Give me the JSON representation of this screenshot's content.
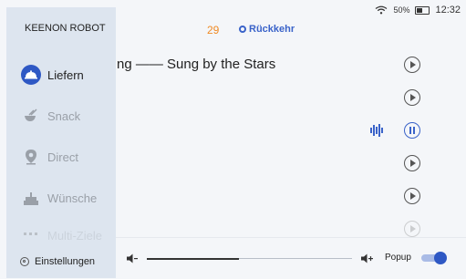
{
  "status": {
    "battery": "50%",
    "time": "12:32"
  },
  "header": {
    "count": "29",
    "back_label": "Rückkehr"
  },
  "songs": [
    {
      "title": "ng —— Sung by the Stars",
      "state": "play"
    },
    {
      "title": "",
      "state": "play"
    },
    {
      "title": "",
      "state": "playing"
    },
    {
      "title": "",
      "state": "play"
    },
    {
      "title": "",
      "state": "play"
    },
    {
      "title": "",
      "state": "play"
    }
  ],
  "sidebar": {
    "brand": "KEENON ROBOT",
    "items": [
      {
        "label": "Liefern",
        "icon": "cloche-icon",
        "active": true
      },
      {
        "label": "Snack",
        "icon": "snack-icon",
        "active": false
      },
      {
        "label": "Direct",
        "icon": "location-pin-icon",
        "active": false
      },
      {
        "label": "Wünsche",
        "icon": "cake-icon",
        "active": false
      },
      {
        "label": "Multi-Ziele",
        "icon": "grid-icon",
        "active": false
      }
    ],
    "settings_label": "Einstellungen"
  },
  "player": {
    "volume_level": 0.45,
    "popup_label": "Popup",
    "popup_enabled": true
  },
  "colors": {
    "accent": "#2e58c4",
    "count": "#f08a24",
    "sidebar_bg": "#dde5ef"
  }
}
